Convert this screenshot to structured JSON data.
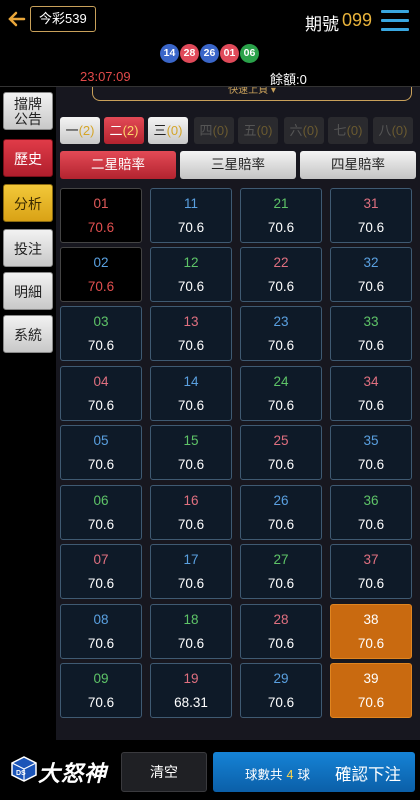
{
  "header": {
    "lottery_label": "今彩539",
    "period_label": "期號",
    "period_number": "099"
  },
  "draw": {
    "balls": [
      {
        "n": "14",
        "color": "#3a66c9"
      },
      {
        "n": "28",
        "color": "#e04a5a"
      },
      {
        "n": "26",
        "color": "#3a66c9"
      },
      {
        "n": "01",
        "color": "#e04a5a"
      },
      {
        "n": "06",
        "color": "#2aa24a"
      }
    ]
  },
  "info": {
    "countdown": "23:07:09",
    "balance": "餘額:0"
  },
  "quickselect": {
    "label": "快速上頁 ▾"
  },
  "sidebar": {
    "items": [
      {
        "label": "擋牌公告",
        "style": "plain",
        "lines": [
          "擋牌",
          "公告"
        ]
      },
      {
        "label": "歷史",
        "style": "red"
      },
      {
        "label": "分析",
        "style": "gold"
      },
      {
        "label": "投注",
        "style": "plain"
      },
      {
        "label": "明細",
        "style": "plain"
      },
      {
        "label": "系統",
        "style": "plain"
      }
    ]
  },
  "tabs": [
    {
      "label": "一",
      "count": "(2)",
      "state": "on"
    },
    {
      "label": "二",
      "count": "(2)",
      "state": "act"
    },
    {
      "label": "三",
      "count": "(0)",
      "state": "on"
    },
    {
      "label": "四",
      "count": "(0)",
      "state": "off"
    },
    {
      "label": "五",
      "count": "(0)",
      "state": "off"
    },
    {
      "label": "六",
      "count": "(0)",
      "state": "off"
    },
    {
      "label": "七",
      "count": "(0)",
      "state": "off"
    },
    {
      "label": "八",
      "count": "(0)",
      "state": "off"
    }
  ],
  "rates": [
    {
      "label": "二星賠率",
      "state": "act"
    },
    {
      "label": "三星賠率",
      "state": "in"
    },
    {
      "label": "四星賠率",
      "state": "in"
    }
  ],
  "numbers": [
    {
      "n": "01",
      "odds": "70.6",
      "color": "#e05a5a",
      "state": "dark"
    },
    {
      "n": "02",
      "odds": "70.6",
      "color": "#5aa0e0",
      "state": "dark"
    },
    {
      "n": "03",
      "odds": "70.6",
      "color": "#5ec468",
      "state": "normal"
    },
    {
      "n": "04",
      "odds": "70.6",
      "color": "#e07080",
      "state": "normal"
    },
    {
      "n": "05",
      "odds": "70.6",
      "color": "#5aa0e0",
      "state": "normal"
    },
    {
      "n": "06",
      "odds": "70.6",
      "color": "#5ec468",
      "state": "normal"
    },
    {
      "n": "07",
      "odds": "70.6",
      "color": "#e07080",
      "state": "normal"
    },
    {
      "n": "08",
      "odds": "70.6",
      "color": "#5aa0e0",
      "state": "normal"
    },
    {
      "n": "09",
      "odds": "70.6",
      "color": "#5ec468",
      "state": "normal"
    },
    {
      "n": "11",
      "odds": "70.6",
      "color": "#5aa0e0",
      "state": "normal"
    },
    {
      "n": "12",
      "odds": "70.6",
      "color": "#5ec468",
      "state": "normal"
    },
    {
      "n": "13",
      "odds": "70.6",
      "color": "#e07080",
      "state": "normal"
    },
    {
      "n": "14",
      "odds": "70.6",
      "color": "#5aa0e0",
      "state": "normal"
    },
    {
      "n": "15",
      "odds": "70.6",
      "color": "#5ec468",
      "state": "normal"
    },
    {
      "n": "16",
      "odds": "70.6",
      "color": "#e07080",
      "state": "normal"
    },
    {
      "n": "17",
      "odds": "70.6",
      "color": "#5aa0e0",
      "state": "normal"
    },
    {
      "n": "18",
      "odds": "70.6",
      "color": "#5ec468",
      "state": "normal"
    },
    {
      "n": "19",
      "odds": "68.31",
      "color": "#e07080",
      "state": "normal"
    },
    {
      "n": "21",
      "odds": "70.6",
      "color": "#5ec468",
      "state": "normal"
    },
    {
      "n": "22",
      "odds": "70.6",
      "color": "#e07080",
      "state": "normal"
    },
    {
      "n": "23",
      "odds": "70.6",
      "color": "#5aa0e0",
      "state": "normal"
    },
    {
      "n": "24",
      "odds": "70.6",
      "color": "#5ec468",
      "state": "normal"
    },
    {
      "n": "25",
      "odds": "70.6",
      "color": "#e07080",
      "state": "normal"
    },
    {
      "n": "26",
      "odds": "70.6",
      "color": "#5aa0e0",
      "state": "normal"
    },
    {
      "n": "27",
      "odds": "70.6",
      "color": "#5ec468",
      "state": "normal"
    },
    {
      "n": "28",
      "odds": "70.6",
      "color": "#e07080",
      "state": "normal"
    },
    {
      "n": "29",
      "odds": "70.6",
      "color": "#5aa0e0",
      "state": "normal"
    },
    {
      "n": "31",
      "odds": "70.6",
      "color": "#e07080",
      "state": "normal"
    },
    {
      "n": "32",
      "odds": "70.6",
      "color": "#5aa0e0",
      "state": "normal"
    },
    {
      "n": "33",
      "odds": "70.6",
      "color": "#5ec468",
      "state": "normal"
    },
    {
      "n": "34",
      "odds": "70.6",
      "color": "#e07080",
      "state": "normal"
    },
    {
      "n": "35",
      "odds": "70.6",
      "color": "#5aa0e0",
      "state": "normal"
    },
    {
      "n": "36",
      "odds": "70.6",
      "color": "#5ec468",
      "state": "normal"
    },
    {
      "n": "37",
      "odds": "70.6",
      "color": "#e07080",
      "state": "normal"
    },
    {
      "n": "38",
      "odds": "70.6",
      "color": "#ffffff",
      "state": "selected"
    },
    {
      "n": "39",
      "odds": "70.6",
      "color": "#ffffff",
      "state": "selected"
    }
  ],
  "footer": {
    "logo_text": "大怒神",
    "logo_mark": "DS",
    "clear_label": "清空",
    "ball_count_prefix": "球數共",
    "ball_count": "4",
    "ball_count_suffix": "球",
    "confirm_label": "確認下注"
  }
}
